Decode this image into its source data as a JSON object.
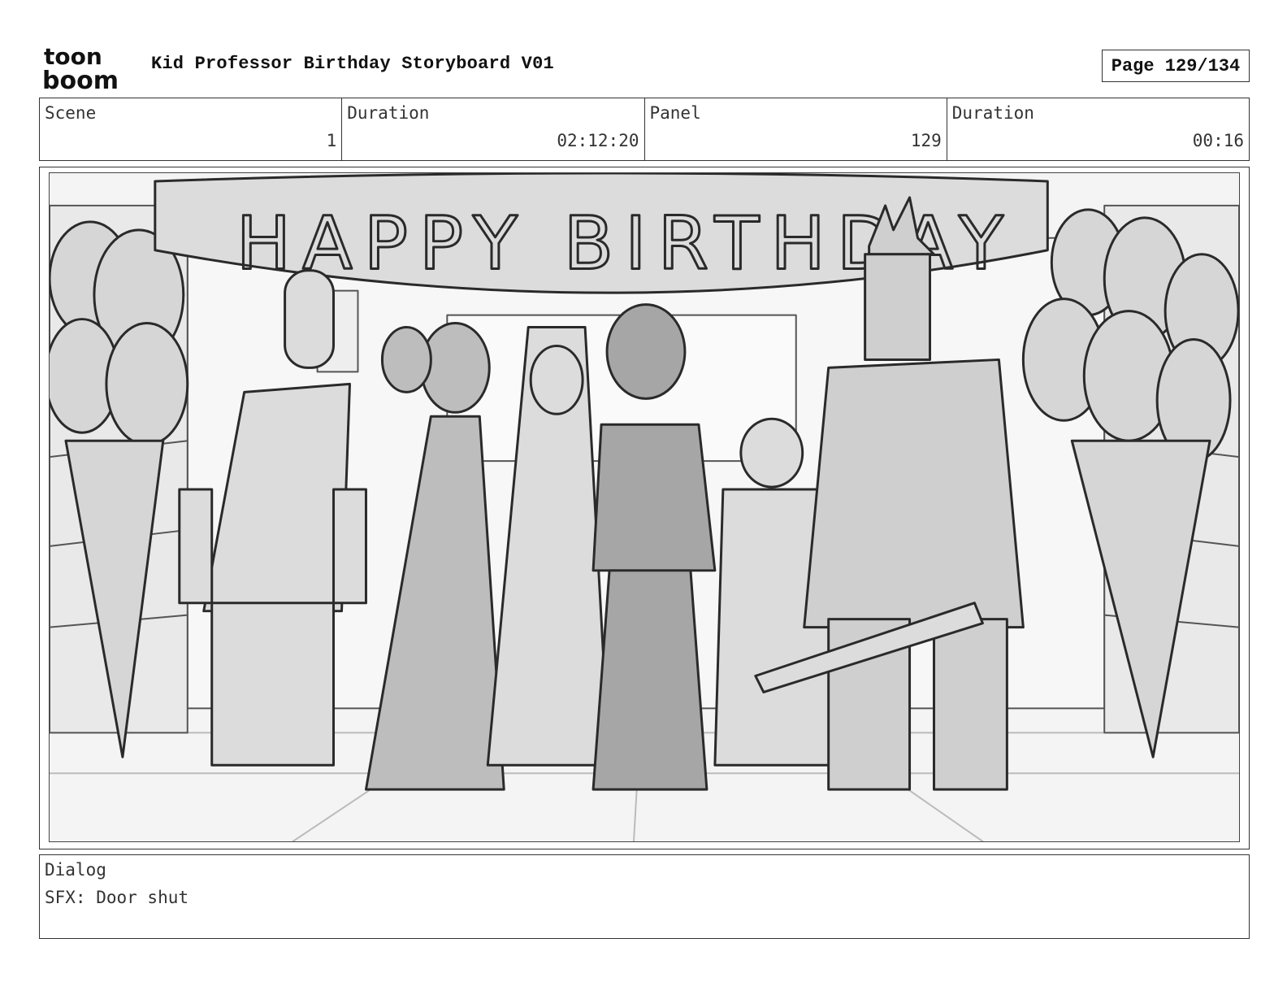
{
  "header": {
    "logo": {
      "top": "toon",
      "bottom": "boom"
    },
    "title": "Kid Professor Birthday Storyboard V01",
    "page": "Page 129/134"
  },
  "info": {
    "scene_label": "Scene",
    "scene_value": "1",
    "duration_label": "Duration",
    "duration_value": "02:12:20",
    "panel_label": "Panel",
    "panel_value": "129",
    "panel_duration_label": "Duration",
    "panel_duration_value": "00:16"
  },
  "panel": {
    "banner_text": "HAPPY BIRTHDAY"
  },
  "dialog": {
    "label": "Dialog",
    "text": "SFX: Door shut"
  },
  "colors": {
    "ink": "#2a2a2a",
    "light_fill": "#dcdcdc",
    "mid_fill": "#bdbdbd",
    "dark_fill": "#a6a6a6"
  }
}
